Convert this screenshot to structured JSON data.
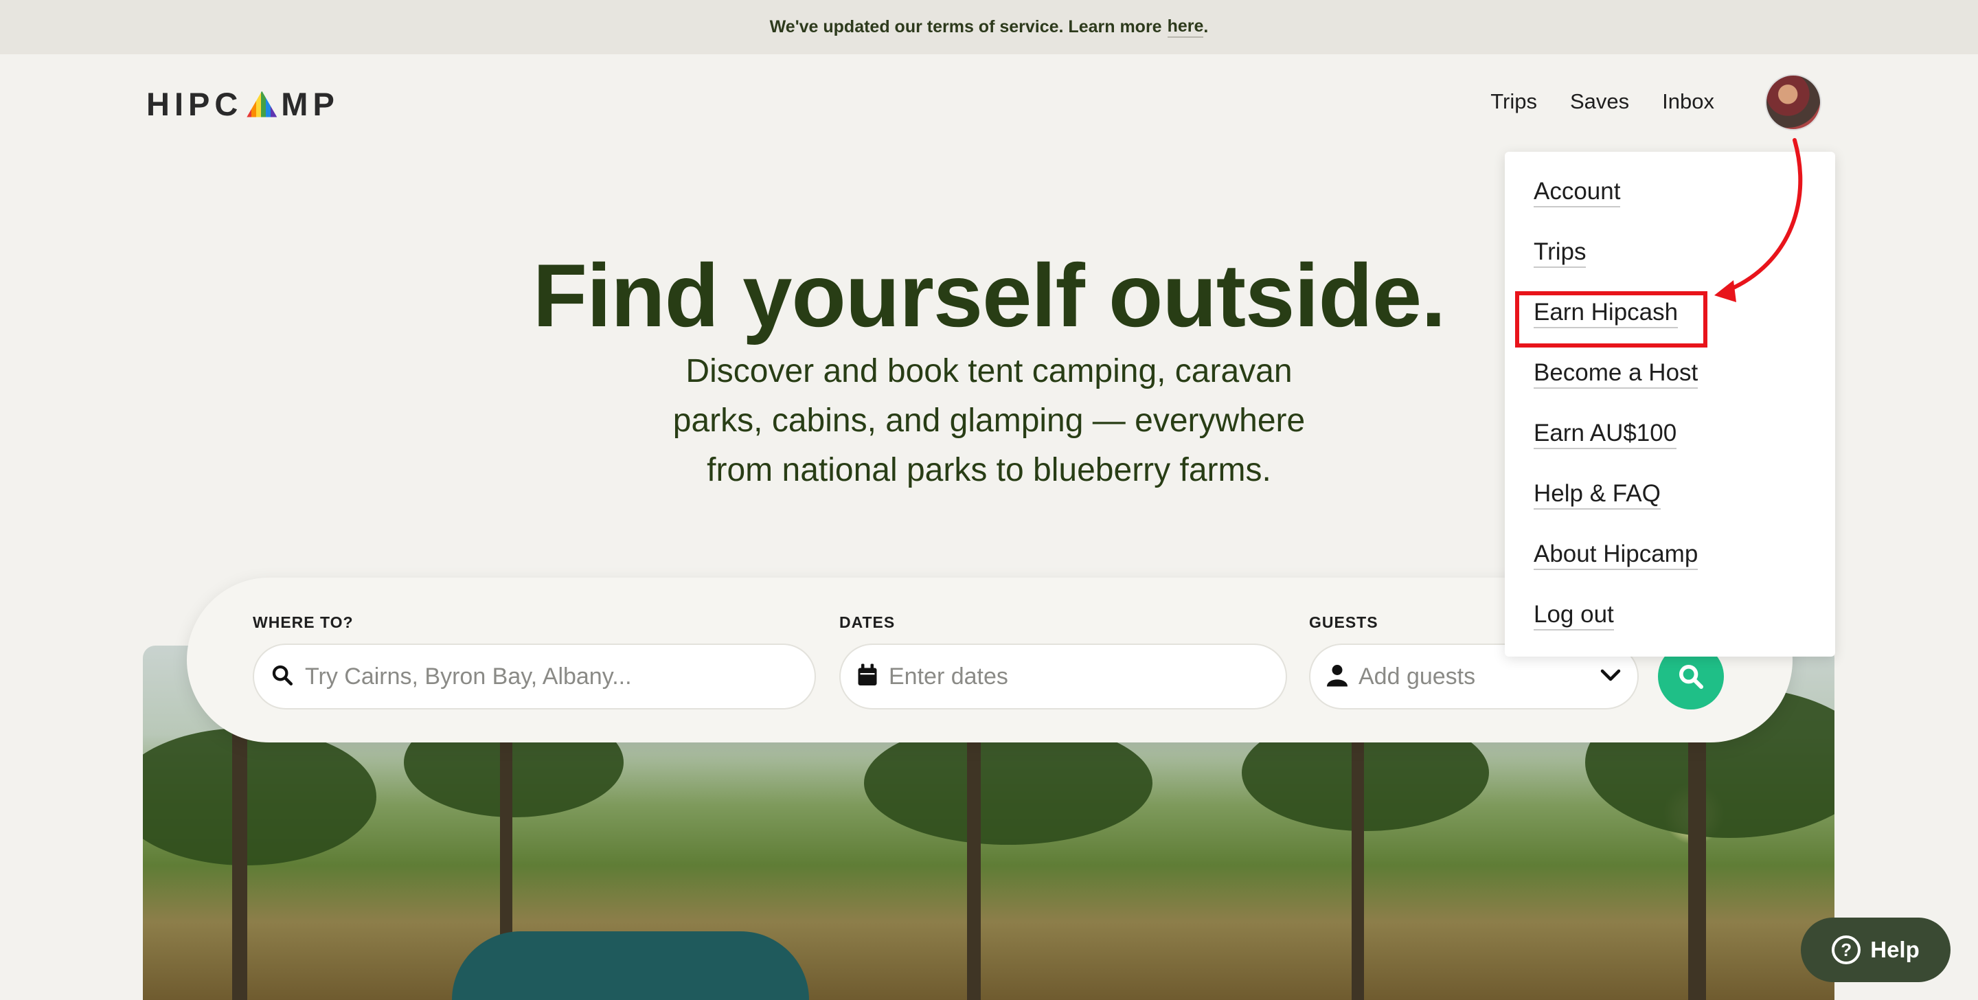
{
  "banner": {
    "text": "We've updated our terms of service. Learn more",
    "link": "here",
    "period": "."
  },
  "header": {
    "logo_left": "HIPC",
    "logo_right": "MP",
    "nav": [
      "Trips",
      "Saves",
      "Inbox"
    ]
  },
  "dropdown": {
    "items": [
      "Account",
      "Trips",
      "Earn Hipcash",
      "Become a Host",
      "Earn AU$100",
      "Help & FAQ",
      "About Hipcamp",
      "Log out"
    ],
    "highlighted": "Earn Hipcash",
    "highlight_color": "#e8141b"
  },
  "hero": {
    "title": "Find yourself outside.",
    "subtitle": "Discover and book tent camping, caravan parks, cabins, and glamping — everywhere from national parks to blueberry farms."
  },
  "search": {
    "where_label": "WHERE TO?",
    "where_placeholder": "Try Cairns, Byron Bay, Albany...",
    "dates_label": "DATES",
    "dates_placeholder": "Enter dates",
    "guests_label": "GUESTS",
    "guests_placeholder": "Add guests",
    "button_color": "#1fbf87"
  },
  "help": {
    "label": "Help"
  },
  "colors": {
    "brand_green": "#283d15",
    "background": "#f3f2ee"
  },
  "icons": [
    "search-icon",
    "calendar-icon",
    "person-icon",
    "chevron-down-icon",
    "help-circle-icon"
  ]
}
